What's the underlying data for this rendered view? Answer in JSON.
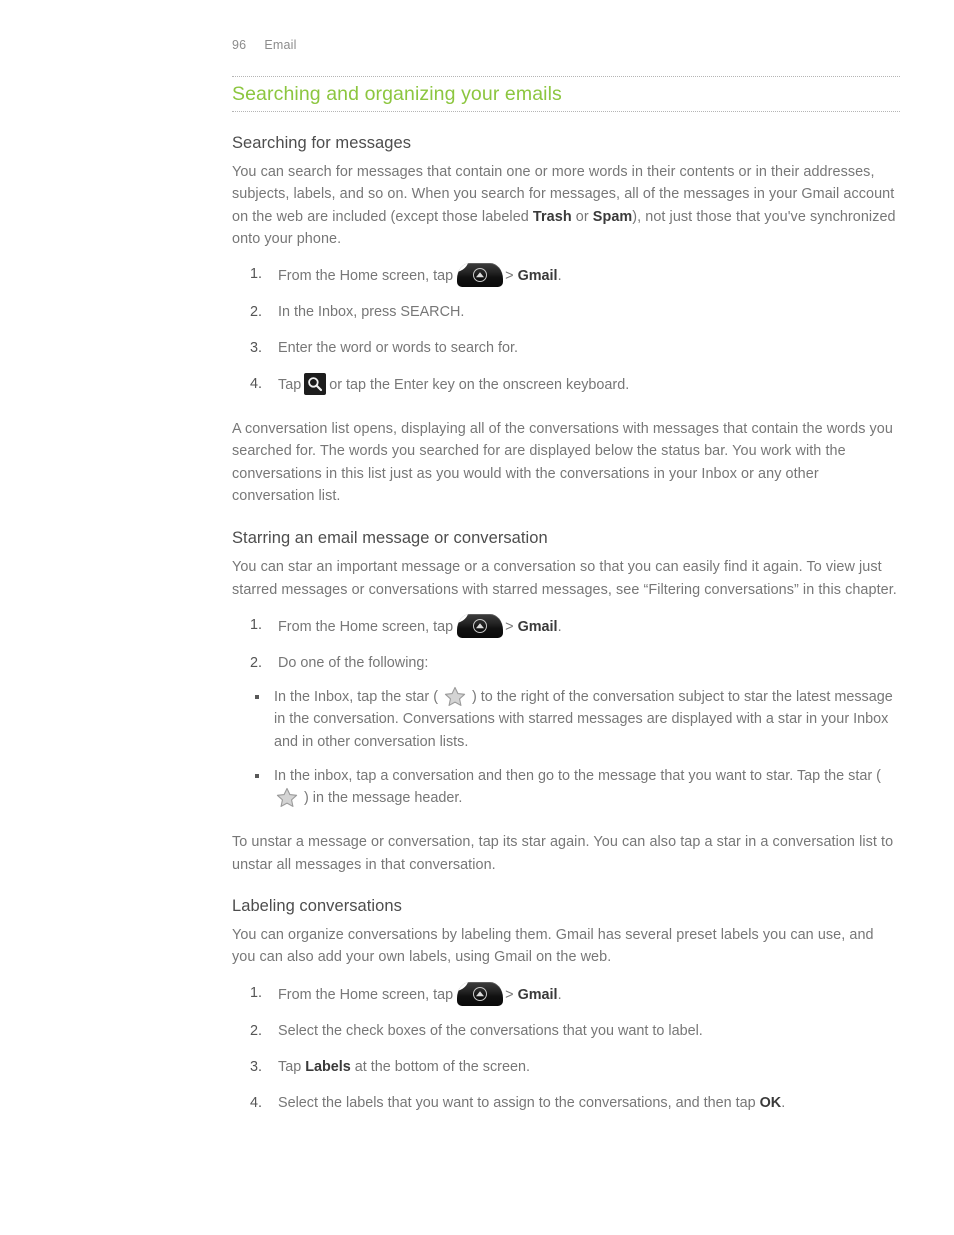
{
  "header": {
    "page_number": "96",
    "chapter": "Email"
  },
  "section": {
    "title": "Searching and organizing your emails"
  },
  "colors": {
    "heading_green": "#8cc63f",
    "body_text": "#777777",
    "rule_dotted": "#b5b5b5",
    "icon_dark": "#1d1d1d",
    "star_fill": "#d4d4d4"
  },
  "searching": {
    "title": "Searching for messages",
    "intro_1": "You can search for messages that contain one or more words in their contents or in their addresses, subjects, labels, and so on. When you search for messages, all of the messages in your Gmail account on the web are included (except those labeled ",
    "intro_bold_1": "Trash",
    "intro_2": " or ",
    "intro_bold_2": "Spam",
    "intro_3": "), not just those that you've synchronized onto your phone.",
    "steps": [
      {
        "text_before": "From the Home screen, tap",
        "icon": "launcher-icon",
        "text_after": "> ",
        "bold": "Gmail",
        "text_end": "."
      },
      {
        "text": "In the Inbox, press SEARCH."
      },
      {
        "text": "Enter the word or words to search for."
      },
      {
        "text_before": "Tap",
        "icon": "search-icon",
        "text_after": "or tap the Enter key on the onscreen keyboard."
      }
    ],
    "result": "A conversation list opens, displaying all of the conversations with messages that contain the words you searched for. The words you searched for are displayed below the status bar. You work with the conversations in this list just as you would with the conversations in your Inbox or any other conversation list."
  },
  "starring": {
    "title": "Starring an email message or conversation",
    "intro": "You can star an important message or a conversation so that you can easily find it again. To view just starred messages or conversations with starred messages, see “Filtering conversations” in this chapter.",
    "steps": [
      {
        "text_before": "From the Home screen, tap",
        "icon": "launcher-icon",
        "text_after": "> ",
        "bold": "Gmail",
        "text_end": "."
      },
      {
        "text": "Do one of the following:"
      }
    ],
    "bullets": [
      {
        "text_before": "In the Inbox, tap the star ( ",
        "icon": "star-icon",
        "text_after": " ) to the right of the conversation subject to star the latest message in the conversation. Conversations with starred messages are displayed with a star in your Inbox and in other conversation lists."
      },
      {
        "text_before": "In the inbox, tap a conversation and then go to the message that you want to star. Tap the star ( ",
        "icon": "star-icon",
        "text_after": " ) in the message header."
      }
    ],
    "outro": "To unstar a message or conversation, tap its star again. You can also tap a star in a conversation list to unstar all messages in that conversation."
  },
  "labeling": {
    "title": "Labeling conversations",
    "intro": "You can organize conversations by labeling them. Gmail has several preset labels you can use, and you can also add your own labels, using Gmail on the web.",
    "steps": [
      {
        "text_before": "From the Home screen, tap",
        "icon": "launcher-icon",
        "text_after": "> ",
        "bold": "Gmail",
        "text_end": "."
      },
      {
        "text": "Select the check boxes of the conversations that you want to label."
      },
      {
        "text_before": "Tap ",
        "bold": "Labels",
        "text_after": " at the bottom of the screen."
      },
      {
        "text_before": "Select the labels that you want to assign to the conversations, and then tap ",
        "bold": "OK",
        "text_after": "."
      }
    ]
  }
}
